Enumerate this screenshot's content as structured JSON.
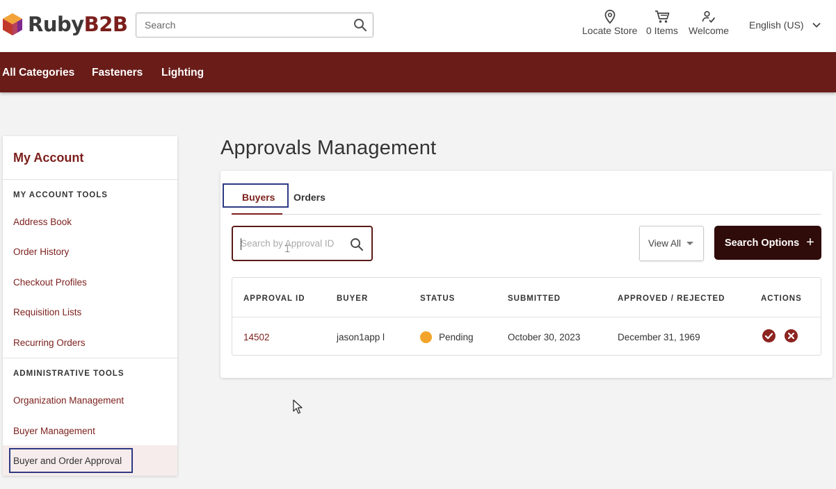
{
  "header": {
    "logo_main": "Ruby",
    "logo_accent": "B2B",
    "search_placeholder": "Search",
    "locate_store": "Locate Store",
    "items": "0 Items",
    "welcome": "Welcome",
    "language": "English (US)"
  },
  "nav": {
    "items": [
      "All Categories",
      "Fasteners",
      "Lighting"
    ]
  },
  "sidebar": {
    "title": "My Account",
    "section_account_tools": "MY ACCOUNT TOOLS",
    "account_links": [
      "Address Book",
      "Order History",
      "Checkout Profiles",
      "Requisition Lists",
      "Recurring Orders"
    ],
    "section_admin_tools": "ADMINISTRATIVE TOOLS",
    "admin_links": [
      "Organization Management",
      "Buyer Management",
      "Buyer and Order Approval"
    ]
  },
  "main": {
    "title": "Approvals Management",
    "tabs": [
      "Buyers",
      "Orders"
    ],
    "active_tab": "Buyers",
    "search_placeholder": "Search by Approval ID",
    "view_all": "View All",
    "search_options": "Search Options",
    "table": {
      "headers": [
        "APPROVAL ID",
        "BUYER",
        "STATUS",
        "SUBMITTED",
        "APPROVED / REJECTED",
        "ACTIONS"
      ],
      "rows": [
        {
          "approval_id": "14502",
          "buyer": "jason1app l",
          "status": "Pending",
          "submitted": "October 30, 2023",
          "approved_rejected": "December 31, 1969"
        }
      ]
    }
  },
  "colors": {
    "brand": "#7b1f1c",
    "nav_bg": "#691c18",
    "button_dark": "#2f0b09",
    "pending": "#f3a52b",
    "focus_outline": "#2e3a82"
  },
  "icons": [
    "logo-cube-icon",
    "search-icon",
    "location-pin-icon",
    "cart-icon",
    "user-check-icon",
    "chevron-down-icon",
    "caret-down-icon",
    "plus-icon",
    "approve-check-icon",
    "reject-x-icon",
    "mouse-pointer-icon"
  ]
}
